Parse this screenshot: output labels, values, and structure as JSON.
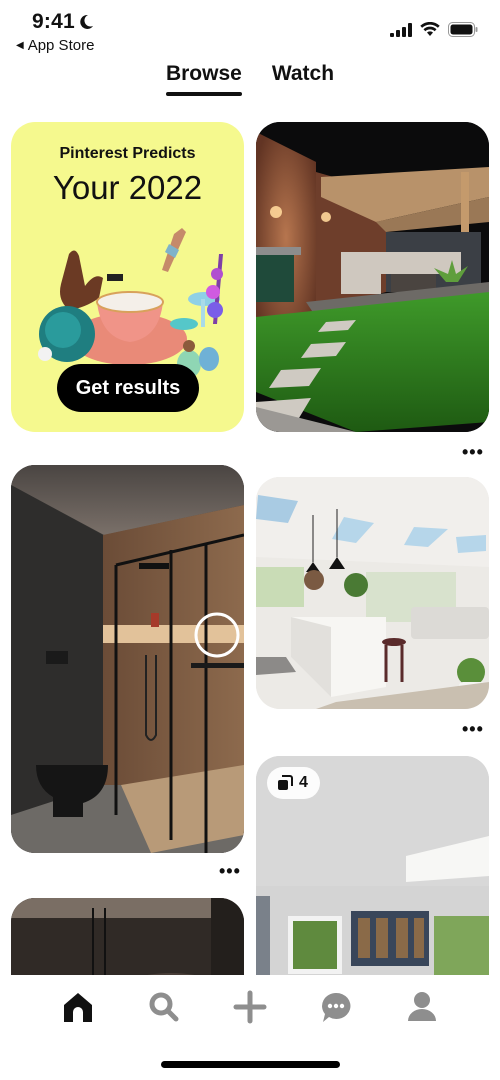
{
  "status_bar": {
    "time": "9:41",
    "back_app": "App Store",
    "icons": [
      "moon-icon",
      "cellular-signal-icon",
      "wifi-icon",
      "battery-icon"
    ]
  },
  "tabs": [
    {
      "label": "Browse",
      "active": true
    },
    {
      "label": "Watch",
      "active": false
    }
  ],
  "feed": {
    "promo": {
      "kicker": "Pinterest Predicts",
      "title": "Your 2022",
      "button_label": "Get results",
      "background_color": "#f5f98e"
    },
    "pins": [
      {
        "name": "patio-pin",
        "description": "Night garden patio with pergola, sofa and artificial grass",
        "more_label": "•••"
      },
      {
        "name": "bathroom-pin",
        "description": "Dark bathroom with wood-panel walk-in shower",
        "more_label": "•••"
      },
      {
        "name": "kitchen-pin",
        "description": "Bright open-plan kitchen with skylights and island",
        "more_label": "•••"
      },
      {
        "name": "kitchen-idea-pin",
        "description": "White kitchen with navy glass cabinets",
        "badge_count": "4",
        "badge_icon": "multi-page-icon"
      },
      {
        "name": "bathroom-pin-2",
        "description": "Dark bathroom ceiling with pendant lights"
      }
    ]
  },
  "bottom_nav": [
    {
      "name": "home",
      "icon": "home-icon",
      "active": true
    },
    {
      "name": "search",
      "icon": "search-icon",
      "active": false
    },
    {
      "name": "create",
      "icon": "plus-icon",
      "active": false
    },
    {
      "name": "messages",
      "icon": "chat-bubble-icon",
      "active": false
    },
    {
      "name": "profile",
      "icon": "person-icon",
      "active": false
    }
  ],
  "colors": {
    "nav_active": "#111111",
    "nav_inactive": "#8e8e8e",
    "promo_button": "#000000"
  }
}
